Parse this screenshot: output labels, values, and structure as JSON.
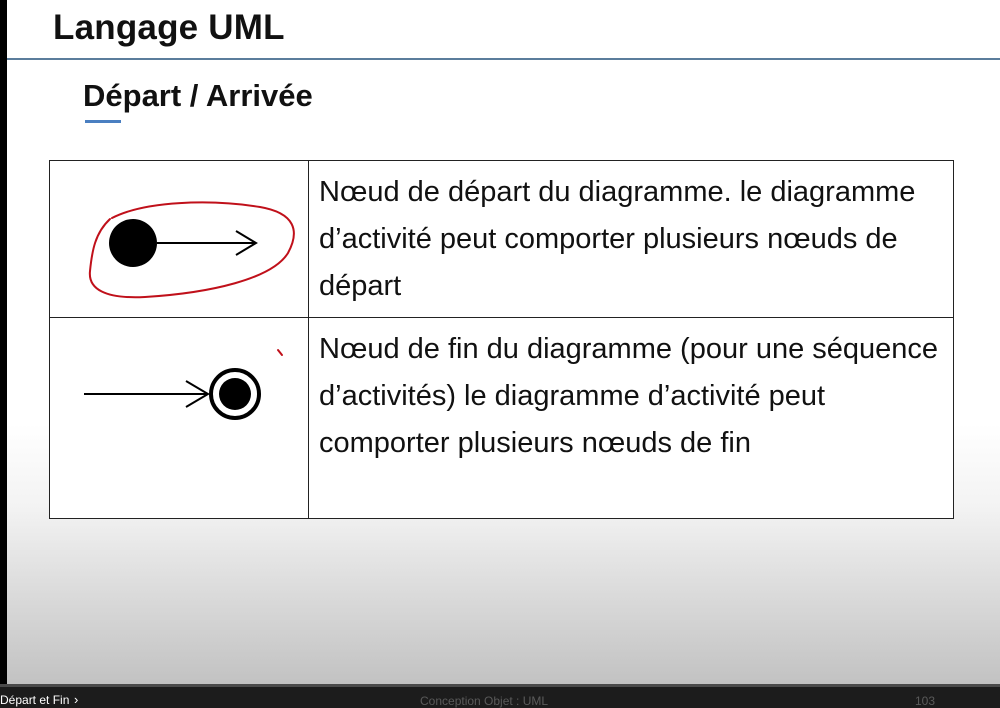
{
  "slide": {
    "title": "Langage UML",
    "subtitle": "Départ / Arrivée",
    "table": {
      "rows": [
        {
          "symbol": "start-node",
          "description": "Nœud de départ du diagramme. le diagramme d’activité peut comporter plusieurs nœuds de départ"
        },
        {
          "symbol": "end-node",
          "description": "Nœud de fin du diagramme (pour une séquence d’activités) le diagramme d’activité peut comporter plusieurs nœuds de fin"
        }
      ]
    },
    "annotation_color": "#c0101a"
  },
  "player": {
    "chapter_label": "Départ et Fin",
    "chevron": "›",
    "footer_text": "Conception Objet : UML",
    "page_number": "103"
  }
}
